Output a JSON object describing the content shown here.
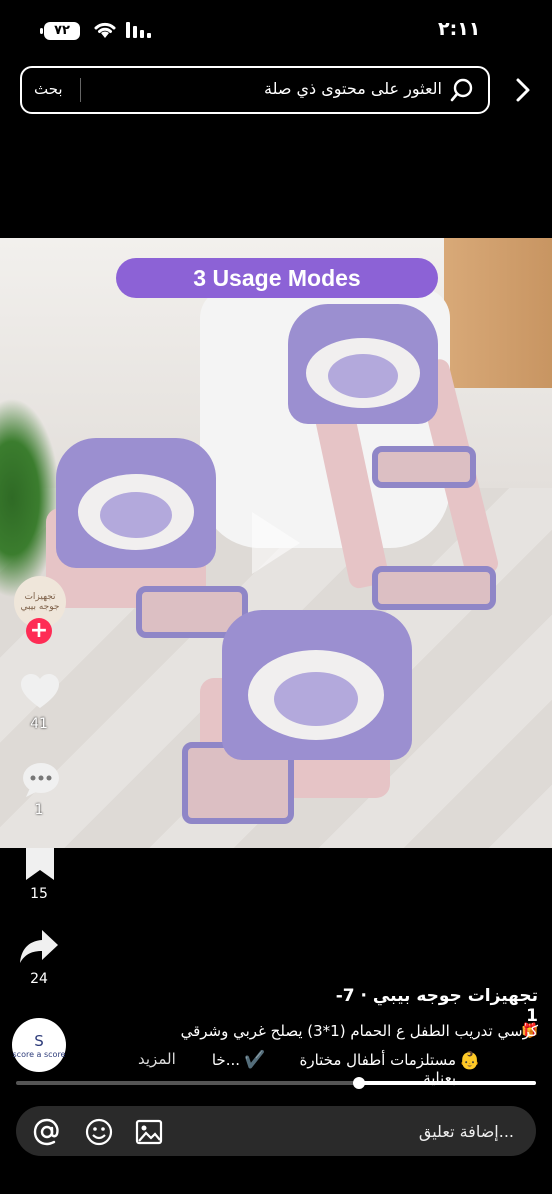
{
  "status_bar": {
    "time": "٢:١١",
    "battery": "٧٢"
  },
  "search": {
    "button_label": "بحث",
    "placeholder": "العثور على محتوى ذي صلة"
  },
  "video": {
    "overlay_title": "3 Usage Modes",
    "watermark_text": "تجهيزات جوجه بيبي"
  },
  "actions": {
    "likes": "41",
    "comments": "1",
    "saves": "15",
    "shares": "24"
  },
  "post": {
    "author_line": "تجهيزات جوجه بيبي · 7-1",
    "caption_line1": "كرسي تدريب الطفل ع الحمام (1*3) يصلح غربي وشرقي",
    "caption_line2_a": "مستلزمات أطفال مختارة بعناية",
    "caption_line2_b": "خا...",
    "more_label": "المزيد",
    "music_logo_top": "S",
    "music_logo_text": "score a score",
    "progress": 0.34
  },
  "comment_bar": {
    "placeholder": "إضافة تعليق..."
  }
}
